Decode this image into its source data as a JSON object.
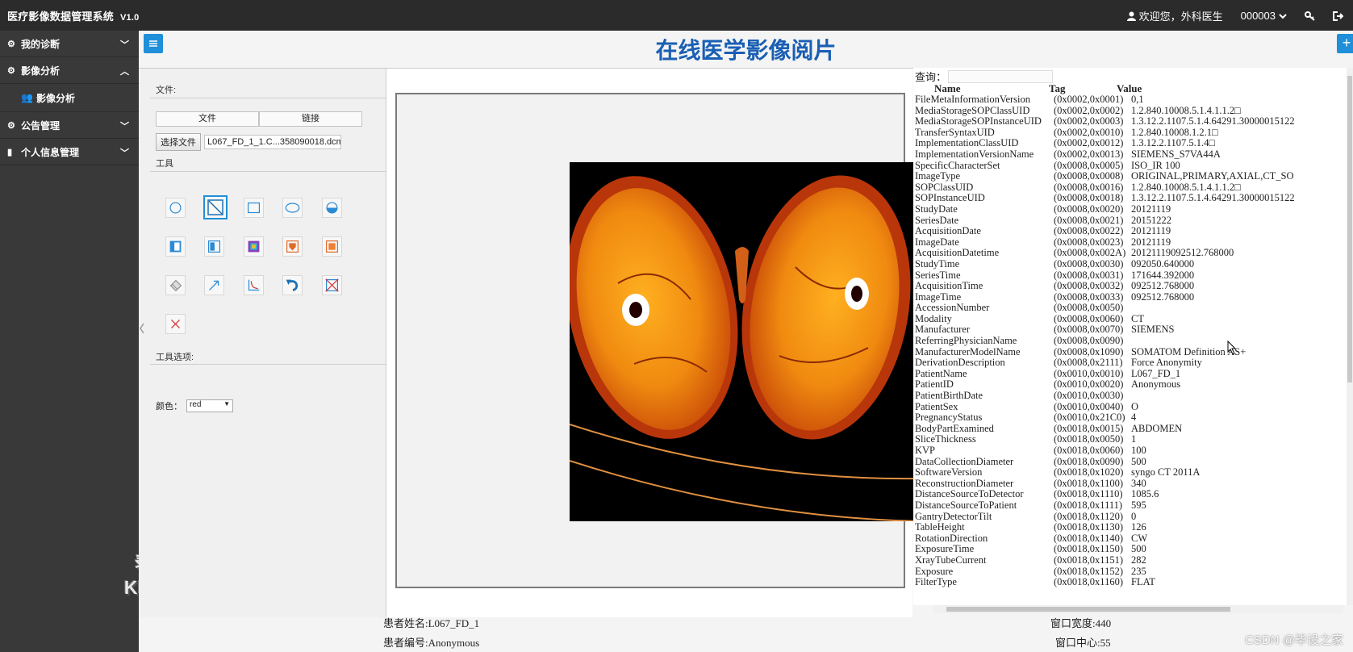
{
  "app": {
    "title": "医疗影像数据管理系统",
    "version": "V1.0"
  },
  "header": {
    "welcome": "欢迎您，外科医生",
    "user_id": "000003",
    "user_icon": "user-icon",
    "key_icon": "key-icon",
    "logout_icon": "logout-icon"
  },
  "sidebar": {
    "items": [
      {
        "label": "我的诊断",
        "icon": "gears-icon",
        "expanded": false
      },
      {
        "label": "影像分析",
        "icon": "gears-icon",
        "expanded": true
      },
      {
        "label": "公告管理",
        "icon": "gears-icon",
        "expanded": false
      },
      {
        "label": "个人信息管理",
        "icon": "book-icon",
        "expanded": false
      }
    ],
    "sub_items": [
      {
        "label": "影像分析",
        "icon": "user-group-icon"
      }
    ]
  },
  "watermark": {
    "line1": "录制工具",
    "line2": "KK录像机"
  },
  "page": {
    "title": "在线医学影像阅片",
    "left_toggle": "≡",
    "right_toggle": "+"
  },
  "tools_panel": {
    "file_label": "文件:",
    "tabs": [
      "文件",
      "链接"
    ],
    "choose_file": "选择文件",
    "file_name": "L067_FD_1_1.C...358090018.dcm",
    "tools_label": "工具",
    "tool_options_label": "工具选项:",
    "color_label": "颜色：",
    "color_value": "red",
    "tools": [
      "circle-tool-icon",
      "line-tool-icon",
      "rectangle-tool-icon",
      "ellipse-tool-icon",
      "half-circle-tool-icon",
      "window-level-icon",
      "invert-icon",
      "colormap-icon",
      "shield-filter-icon",
      "roi-fill-icon",
      "eraser-icon",
      "arrow-tool-icon",
      "curve-tool-icon",
      "undo-icon",
      "clear-shapes-icon",
      "delete-icon"
    ],
    "active_tool": 1
  },
  "info_panel": {
    "query_label": "查询：",
    "columns": [
      "Name",
      "Tag",
      "Value"
    ],
    "rows": [
      [
        "FileMetaInformationVersion",
        "(0x0002,0x0001)",
        "0,1"
      ],
      [
        "MediaStorageSOPClassUID",
        "(0x0002,0x0002)",
        "1.2.840.10008.5.1.4.1.1.2□"
      ],
      [
        "MediaStorageSOPInstanceUID",
        "(0x0002,0x0003)",
        "1.3.12.2.1107.5.1.4.64291.30000015122"
      ],
      [
        "TransferSyntaxUID",
        "(0x0002,0x0010)",
        "1.2.840.10008.1.2.1□"
      ],
      [
        "ImplementationClassUID",
        "(0x0002,0x0012)",
        "1.3.12.2.1107.5.1.4□"
      ],
      [
        "ImplementationVersionName",
        "(0x0002,0x0013)",
        "SIEMENS_S7VA44A"
      ],
      [
        "SpecificCharacterSet",
        "(0x0008,0x0005)",
        "ISO_IR 100"
      ],
      [
        "ImageType",
        "(0x0008,0x0008)",
        "ORIGINAL,PRIMARY,AXIAL,CT_SO"
      ],
      [
        "SOPClassUID",
        "(0x0008,0x0016)",
        "1.2.840.10008.5.1.4.1.1.2□"
      ],
      [
        "SOPInstanceUID",
        "(0x0008,0x0018)",
        "1.3.12.2.1107.5.1.4.64291.30000015122"
      ],
      [
        "StudyDate",
        "(0x0008,0x0020)",
        "20121119"
      ],
      [
        "SeriesDate",
        "(0x0008,0x0021)",
        "20151222"
      ],
      [
        "AcquisitionDate",
        "(0x0008,0x0022)",
        "20121119"
      ],
      [
        "ImageDate",
        "(0x0008,0x0023)",
        "20121119"
      ],
      [
        "AcquisitionDatetime",
        "(0x0008,0x002A)",
        "20121119092512.768000"
      ],
      [
        "StudyTime",
        "(0x0008,0x0030)",
        "092050.640000"
      ],
      [
        "SeriesTime",
        "(0x0008,0x0031)",
        "171644.392000"
      ],
      [
        "AcquisitionTime",
        "(0x0008,0x0032)",
        "092512.768000"
      ],
      [
        "ImageTime",
        "(0x0008,0x0033)",
        "092512.768000"
      ],
      [
        "AccessionNumber",
        "(0x0008,0x0050)",
        ""
      ],
      [
        "Modality",
        "(0x0008,0x0060)",
        "CT"
      ],
      [
        "Manufacturer",
        "(0x0008,0x0070)",
        "SIEMENS"
      ],
      [
        "ReferringPhysicianName",
        "(0x0008,0x0090)",
        ""
      ],
      [
        "ManufacturerModelName",
        "(0x0008,0x1090)",
        "SOMATOM Definition AS+"
      ],
      [
        "DerivationDescription",
        "(0x0008,0x2111)",
        "Force Anonymity"
      ],
      [
        "PatientName",
        "(0x0010,0x0010)",
        "L067_FD_1"
      ],
      [
        "PatientID",
        "(0x0010,0x0020)",
        "Anonymous"
      ],
      [
        "PatientBirthDate",
        "(0x0010,0x0030)",
        ""
      ],
      [
        "PatientSex",
        "(0x0010,0x0040)",
        "O"
      ],
      [
        "PregnancyStatus",
        "(0x0010,0x21C0)",
        "4"
      ],
      [
        "BodyPartExamined",
        "(0x0018,0x0015)",
        "ABDOMEN"
      ],
      [
        "SliceThickness",
        "(0x0018,0x0050)",
        "1"
      ],
      [
        "KVP",
        "(0x0018,0x0060)",
        "100"
      ],
      [
        "DataCollectionDiameter",
        "(0x0018,0x0090)",
        "500"
      ],
      [
        "SoftwareVersion",
        "(0x0018,0x1020)",
        "syngo CT 2011A"
      ],
      [
        "ReconstructionDiameter",
        "(0x0018,0x1100)",
        "340"
      ],
      [
        "DistanceSourceToDetector",
        "(0x0018,0x1110)",
        "1085.6"
      ],
      [
        "DistanceSourceToPatient",
        "(0x0018,0x1111)",
        "595"
      ],
      [
        "GantryDetectorTilt",
        "(0x0018,0x1120)",
        "0"
      ],
      [
        "TableHeight",
        "(0x0018,0x1130)",
        "126"
      ],
      [
        "RotationDirection",
        "(0x0018,0x1140)",
        "CW"
      ],
      [
        "ExposureTime",
        "(0x0018,0x1150)",
        "500"
      ],
      [
        "XrayTubeCurrent",
        "(0x0018,0x1151)",
        "282"
      ],
      [
        "Exposure",
        "(0x0018,0x1152)",
        "235"
      ],
      [
        "FilterType",
        "(0x0018,0x1160)",
        "FLAT"
      ]
    ]
  },
  "footer": {
    "patient_name": "患者姓名:L067_FD_1",
    "patient_id": "患者编号:Anonymous",
    "window_width": "窗口宽度:440",
    "window_center": "窗口中心:55"
  },
  "csdn": "CSDN @毕设之家"
}
